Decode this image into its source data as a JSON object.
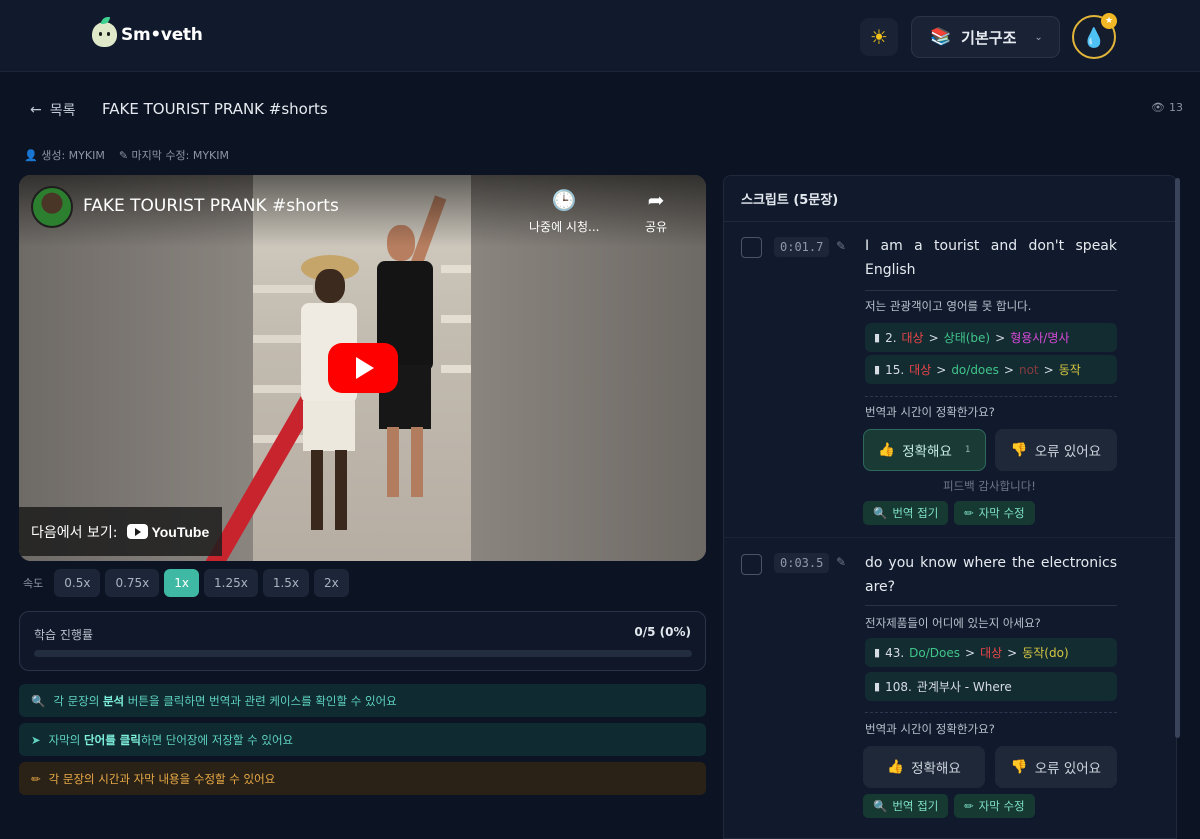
{
  "header": {
    "logo_text": "Sm•veth",
    "theme_icon": "sun-icon",
    "level_label": "기본구조",
    "avatar_icon": "water-drop-icon"
  },
  "page": {
    "back_label": "목록",
    "title": "FAKE TOURIST PRANK #shorts",
    "views": "13",
    "created_label": "생성: MYKIM",
    "modified_label": "마지막 수정: MYKIM"
  },
  "video": {
    "title": "FAKE TOURIST PRANK #shorts",
    "watch_later": "나중에 시청...",
    "share": "공유",
    "watch_on": "다음에서 보기:",
    "youtube": "YouTube"
  },
  "speed": {
    "label": "속도",
    "options": [
      "0.5x",
      "0.75x",
      "1x",
      "1.25x",
      "1.5x",
      "2x"
    ],
    "selected": "1x"
  },
  "progress": {
    "label": "학습 진행률",
    "value": "0/5 (0%)",
    "fraction": 0
  },
  "tips": [
    {
      "pre": "각 문장의 ",
      "bold": "분석",
      "post": " 버튼을 클릭하면 번역과 관련 케이스를 확인할 수 있어요"
    },
    {
      "pre": "자막의 ",
      "bold": "단어를 클릭",
      "post": "하면 단어장에 저장할 수 있어요"
    },
    {
      "pre": "각 문장의 시간과 자막 내용을 수정할 수 있어요",
      "bold": "",
      "post": ""
    }
  ],
  "script": {
    "header": "스크립트 (5문장)",
    "sentences": [
      {
        "time": "0:01.7",
        "en": "I am a tourist and don't speak English",
        "ko": "저는 관광객이고 영어를 못 합니다.",
        "question": "번역과 시간이 정확한가요?",
        "ok_label": "정확해요",
        "ok_count": "1",
        "err_label": "오류 있어요",
        "thanks": "피드백 감사합니다!",
        "fold_label": "번역 접기",
        "edit_label": "자막 수정"
      },
      {
        "time": "0:03.5",
        "en": "do you know where the electronics are?",
        "ko": "전자제품들이 어디에 있는지 아세요?",
        "question": "번역과 시간이 정확한가요?",
        "ok_label": "정확해요",
        "err_label": "오류 있어요",
        "fold_label": "번역 접기",
        "edit_label": "자막 수정"
      }
    ],
    "grammar": {
      "g1": {
        "num": "2.",
        "a": "대상",
        "b": "상태(be)",
        "c": "형용사/명사"
      },
      "g2": {
        "num": "15.",
        "a": "대상",
        "b": "do/does",
        "c": "not",
        "d": "동작"
      },
      "g3": {
        "num": "43.",
        "a": "Do/Does",
        "b": "대상",
        "c": "동작(do)"
      },
      "g4": {
        "num": "108.",
        "a": "관계부사 - Where"
      }
    }
  },
  "colors": {
    "accent": "#3fb8a4",
    "background": "#0c1322"
  }
}
